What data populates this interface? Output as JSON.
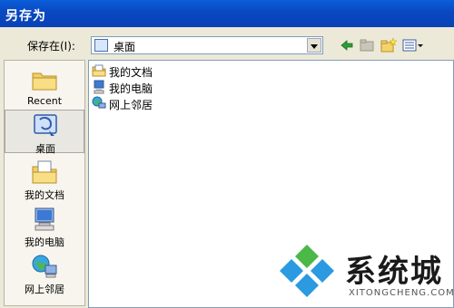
{
  "window": {
    "title": "另存为"
  },
  "toolbar": {
    "save_in_label": "保存在(I):",
    "location_value": "桌面",
    "back_icon": "back-arrow-icon",
    "up_icon": "up-folder-icon",
    "new_folder_icon": "new-folder-icon",
    "views_icon": "views-menu-icon"
  },
  "sidebar": {
    "items": [
      {
        "label": "Recent",
        "icon": "recent-folder-icon"
      },
      {
        "label": "桌面",
        "icon": "desktop-icon",
        "selected": true
      },
      {
        "label": "我的文档",
        "icon": "my-documents-icon"
      },
      {
        "label": "我的电脑",
        "icon": "my-computer-icon"
      },
      {
        "label": "网上邻居",
        "icon": "network-places-icon"
      }
    ]
  },
  "files": [
    {
      "label": "我的文档",
      "icon": "my-documents-icon"
    },
    {
      "label": "我的电脑",
      "icon": "my-computer-icon"
    },
    {
      "label": "网上邻居",
      "icon": "network-places-icon"
    }
  ],
  "watermark": {
    "text": "系统城",
    "domain": "XITONGCHENG.COM"
  },
  "colors": {
    "titlebar": "#0a49c4",
    "window_bg": "#ece9d8",
    "border": "#7f9db9"
  }
}
